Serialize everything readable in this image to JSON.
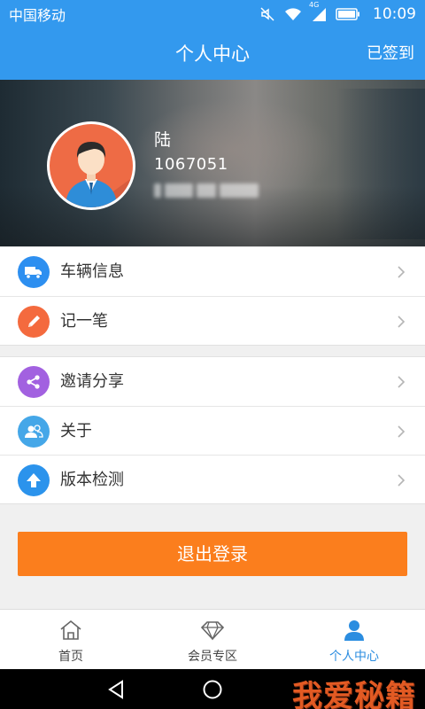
{
  "status_bar": {
    "carrier": "中国移动",
    "network": "4G",
    "time": "10:09"
  },
  "nav": {
    "title": "个人中心",
    "action": "已签到"
  },
  "profile": {
    "name": "陆",
    "id": "1067051"
  },
  "menu_group_1": [
    {
      "label": "车辆信息",
      "icon": "truck-icon",
      "color": "#2d8ff0"
    },
    {
      "label": "记一笔",
      "icon": "pencil-icon",
      "color": "#f46a3e"
    }
  ],
  "menu_group_2": [
    {
      "label": "邀请分享",
      "icon": "share-icon",
      "color": "#a261e0"
    },
    {
      "label": "关于",
      "icon": "users-icon",
      "color": "#45a7e8"
    },
    {
      "label": "版本检测",
      "icon": "upload-arrow-icon",
      "color": "#2b93ec"
    }
  ],
  "logout": {
    "label": "退出登录",
    "color": "#fb7e1d"
  },
  "tab_bar": {
    "active": "个人中心",
    "tabs": [
      {
        "label": "首页",
        "icon": "home-icon"
      },
      {
        "label": "会员专区",
        "icon": "diamond-icon"
      },
      {
        "label": "个人中心",
        "icon": "person-icon"
      }
    ]
  },
  "watermark": "我爱秘籍",
  "colors": {
    "primary": "#3399ee",
    "accent": "#fb7e1d",
    "active_tab": "#2b8de0"
  }
}
